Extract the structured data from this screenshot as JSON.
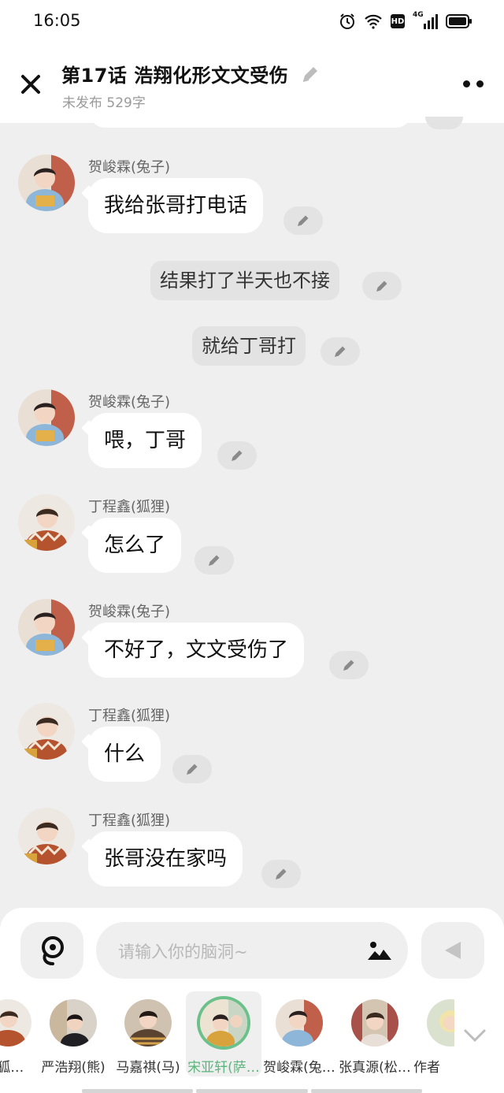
{
  "status": {
    "time": "16:05",
    "network": "4G",
    "hd": "HD"
  },
  "header": {
    "title": "第17话   浩翔化形文文受伤",
    "subtitle": "未发布 529字"
  },
  "messages": [
    {
      "type": "dialog",
      "speaker": "贺峻霖(兔子)",
      "text": "我给张哥打电话",
      "avatar": "he"
    },
    {
      "type": "narration",
      "text": "结果打了半天也不接"
    },
    {
      "type": "narration",
      "text": "就给丁哥打"
    },
    {
      "type": "dialog",
      "speaker": "贺峻霖(兔子)",
      "text": "喂，丁哥",
      "avatar": "he"
    },
    {
      "type": "dialog",
      "speaker": "丁程鑫(狐狸)",
      "text": "怎么了",
      "avatar": "ding"
    },
    {
      "type": "dialog",
      "speaker": "贺峻霖(兔子)",
      "text": "不好了，文文受伤了",
      "avatar": "he"
    },
    {
      "type": "dialog",
      "speaker": "丁程鑫(狐狸)",
      "text": "什么",
      "avatar": "ding"
    },
    {
      "type": "dialog",
      "speaker": "丁程鑫(狐狸)",
      "text": "张哥没在家吗",
      "avatar": "ding"
    }
  ],
  "composer": {
    "placeholder": "请输入你的脑洞~"
  },
  "characters": [
    {
      "name": "(狐…",
      "avatar": "ding"
    },
    {
      "name": "严浩翔(熊)",
      "avatar": "yan"
    },
    {
      "name": "马嘉祺(马)",
      "avatar": "ma"
    },
    {
      "name": "宋亚轩(萨…",
      "avatar": "song",
      "selected": true
    },
    {
      "name": "贺峻霖(兔…",
      "avatar": "he"
    },
    {
      "name": "张真源(松…",
      "avatar": "zhang"
    },
    {
      "name": "作者",
      "avatar": "author"
    }
  ],
  "colors": {
    "selected": "#5cb57d",
    "background": "#efefef",
    "bubble": "#ffffff"
  }
}
